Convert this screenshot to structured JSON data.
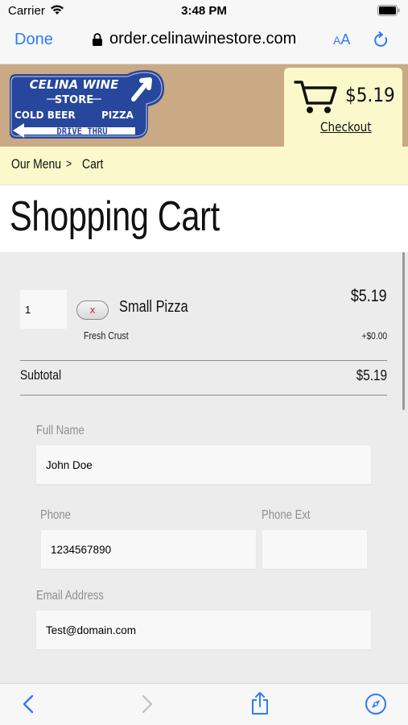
{
  "status_bar": {
    "carrier": "Carrier",
    "time": "3:48 PM"
  },
  "browser": {
    "done_label": "Done",
    "url": "order.celinawinestore.com",
    "text_size_large": "A",
    "text_size_small": "A"
  },
  "logo": {
    "line1": "CELINA WINE",
    "line2": "STORE",
    "line3_left": "COLD BEER",
    "line3_right": "PIZZA",
    "line4": "DRIVE THRU"
  },
  "cart": {
    "total": "$5.19",
    "checkout_label": "Checkout"
  },
  "breadcrumb": {
    "menu": "Our Menu",
    "separator": ">",
    "current": "Cart"
  },
  "page_title": "Shopping Cart",
  "cart_items": [
    {
      "quantity": "1",
      "remove_label": "x",
      "name": "Small Pizza",
      "price": "$5.19",
      "option": "Fresh Crust",
      "option_price": "+$0.00"
    }
  ],
  "subtotal": {
    "label": "Subtotal",
    "value": "$5.19"
  },
  "form": {
    "full_name": {
      "label": "Full Name",
      "value": "John Doe"
    },
    "phone": {
      "label": "Phone",
      "value": "1234567890"
    },
    "phone_ext": {
      "label": "Phone Ext",
      "value": ""
    },
    "email": {
      "label": "Email Address",
      "value": "Test@domain.com"
    }
  },
  "toolbar_icons": [
    "back-icon",
    "forward-icon",
    "share-icon",
    "compass-icon"
  ],
  "colors": {
    "accent": "#2f7cf6",
    "header_tan": "#c9aa85",
    "cream": "#fbf8cc",
    "logo_blue": "#26479b",
    "remove_red": "#e02020"
  }
}
